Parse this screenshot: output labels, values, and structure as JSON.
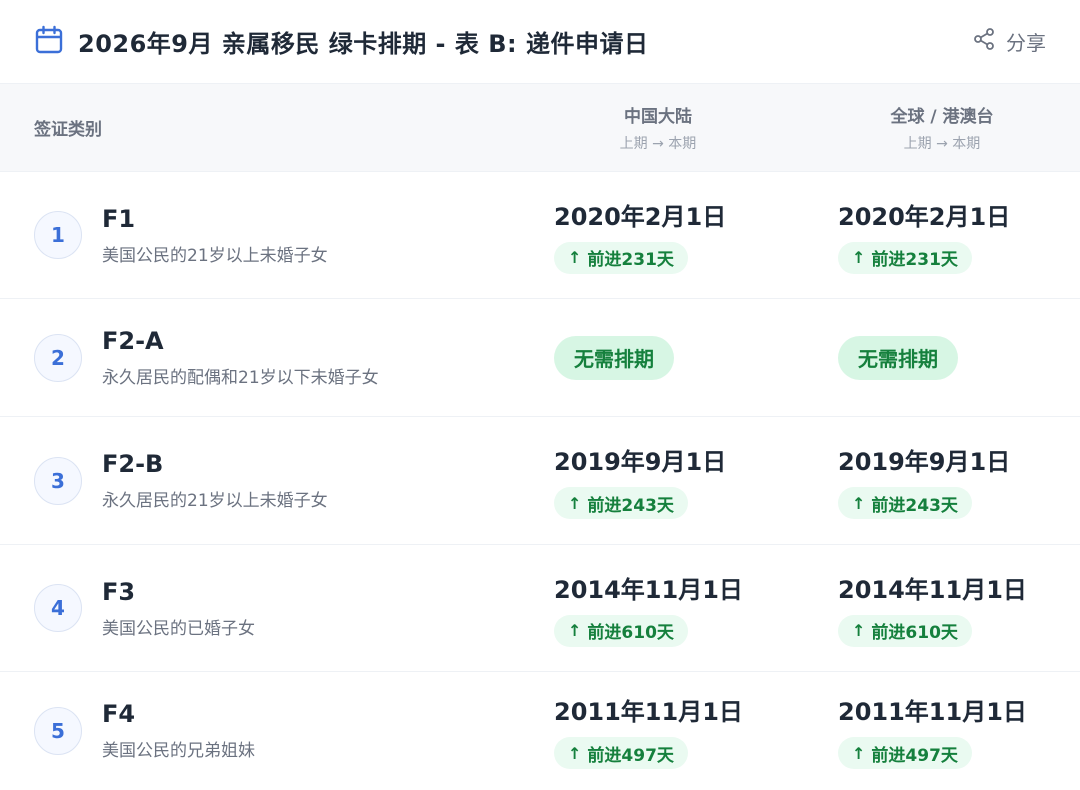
{
  "header": {
    "title": "2026年9月 亲属移民 绿卡排期 - 表 B: 递件申请日",
    "share_label": "分享",
    "calendar_icon": "calendar-icon",
    "share_icon": "share-icon"
  },
  "table": {
    "col_category": "签证类别",
    "col_china": "中国大陆",
    "col_global": "全球 / 港澳台",
    "col_sub": "上期 → 本期",
    "rows": [
      {
        "index": "1",
        "code": "F1",
        "desc": "美国公民的21岁以上未婚子女",
        "china": {
          "date": "2020年2月1日",
          "advance": "前进231天"
        },
        "global": {
          "date": "2020年2月1日",
          "advance": "前进231天"
        }
      },
      {
        "index": "2",
        "code": "F2-A",
        "desc": "永久居民的配偶和21岁以下未婚子女",
        "china": {
          "status": "无需排期"
        },
        "global": {
          "status": "无需排期"
        }
      },
      {
        "index": "3",
        "code": "F2-B",
        "desc": "永久居民的21岁以上未婚子女",
        "china": {
          "date": "2019年9月1日",
          "advance": "前进243天"
        },
        "global": {
          "date": "2019年9月1日",
          "advance": "前进243天"
        }
      },
      {
        "index": "4",
        "code": "F3",
        "desc": "美国公民的已婚子女",
        "china": {
          "date": "2014年11月1日",
          "advance": "前进610天"
        },
        "global": {
          "date": "2014年11月1日",
          "advance": "前进610天"
        }
      },
      {
        "index": "5",
        "code": "F4",
        "desc": "美国公民的兄弟姐妹",
        "china": {
          "date": "2011年11月1日",
          "advance": "前进497天"
        },
        "global": {
          "date": "2011年11月1日",
          "advance": "前进497天"
        }
      }
    ]
  },
  "colors": {
    "accent": "#3b6fd8",
    "advance_text": "#15803d",
    "advance_bg": "#eafaf1",
    "current_bg": "#d7f6e4"
  }
}
